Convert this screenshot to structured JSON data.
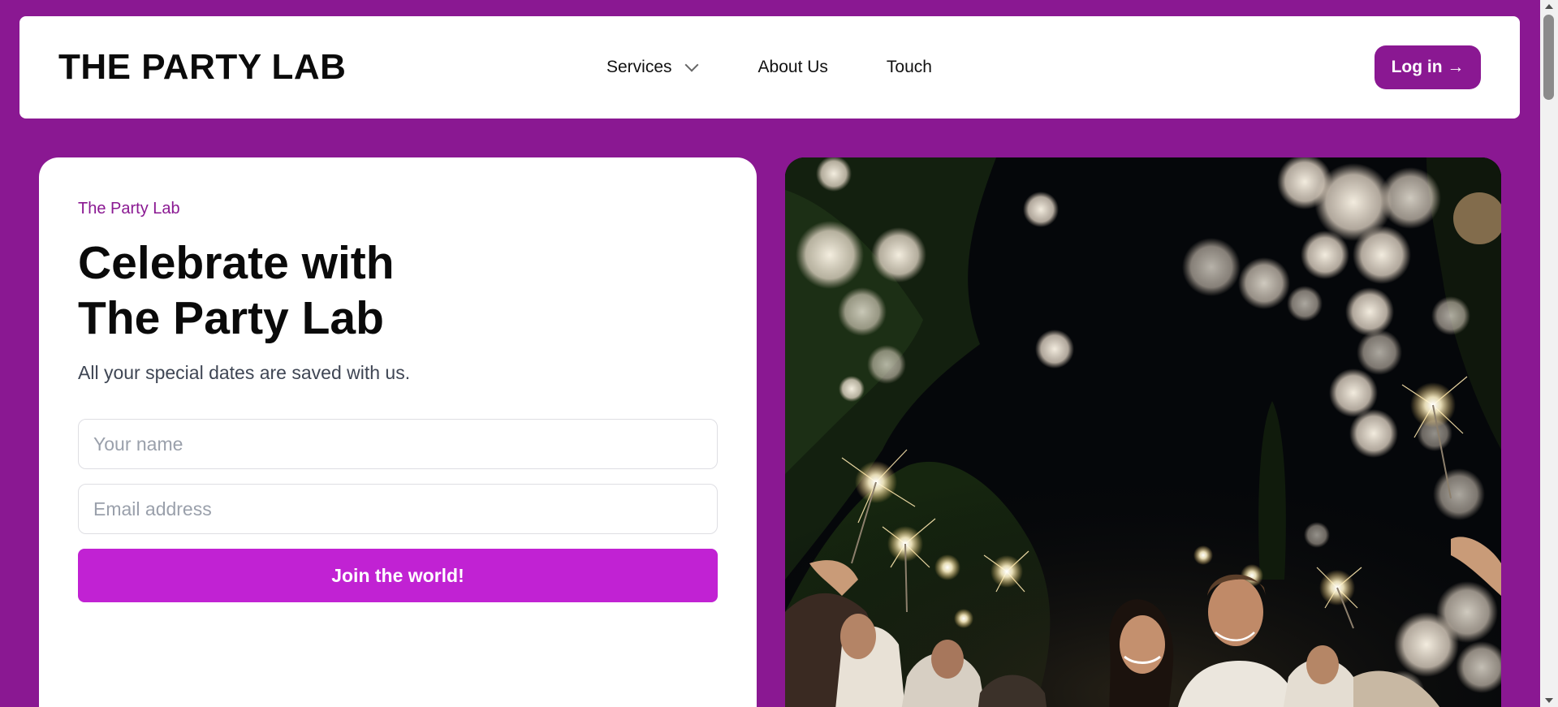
{
  "header": {
    "brand": "THE PARTY LAB",
    "nav": [
      {
        "label": "Services",
        "icon": "chevron-down-icon"
      },
      {
        "label": "About Us"
      },
      {
        "label": "Touch"
      }
    ],
    "login_label": "Log in →"
  },
  "hero": {
    "eyebrow": "The Party Lab",
    "title_line1": "Celebrate with",
    "title_line2": "The Party Lab",
    "subtitle": "All your special dates are saved with us.",
    "name_placeholder": "Your name",
    "email_placeholder": "Email address",
    "join_label": "Join the world!"
  },
  "colors": {
    "background": "#8a1892",
    "accent_button": "#c122d3",
    "login_button": "#8a1892",
    "eyebrow_text": "#8a1892"
  }
}
